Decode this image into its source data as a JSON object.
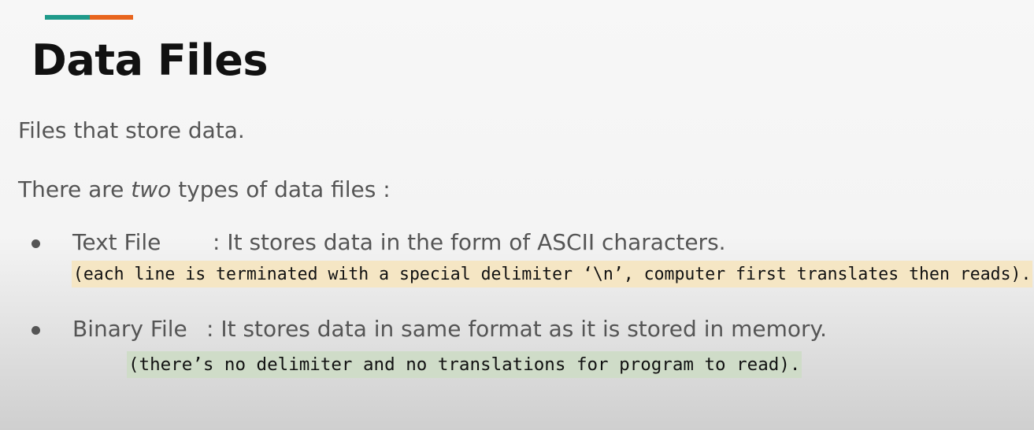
{
  "colors": {
    "accent_teal": "#1f9a8a",
    "accent_orange": "#e8651e",
    "highlight_yellow": "#f5e6c4",
    "highlight_green": "#cfdcc8"
  },
  "slide": {
    "title": "Data Files",
    "intro": "Files that store data.",
    "types_prefix": "There are ",
    "types_em": "two",
    "types_suffix": " types of data files :",
    "items": [
      {
        "term": "Text File",
        "desc": ": It stores data in the form of ASCII characters.",
        "note": "(each line is terminated with a special delimiter ‘\\n’, computer first translates then reads)."
      },
      {
        "term": "Binary File",
        "desc": ": It stores data in same format as it is stored in memory.",
        "note": "(there’s no delimiter and no translations for program to read)."
      }
    ]
  }
}
